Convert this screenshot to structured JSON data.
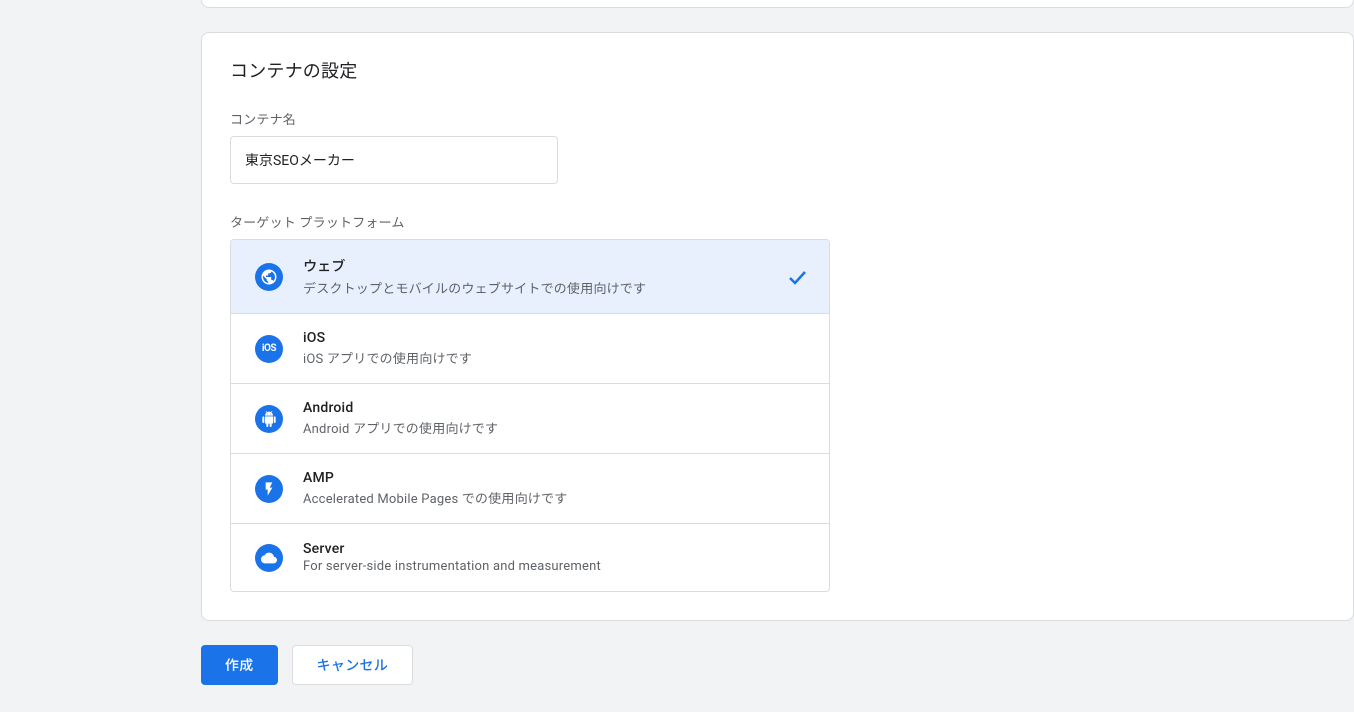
{
  "card": {
    "title": "コンテナの設定",
    "name_label": "コンテナ名",
    "name_value": "東京SEOメーカー",
    "platform_label": "ターゲット プラットフォーム"
  },
  "platforms": {
    "web": {
      "title": "ウェブ",
      "desc": "デスクトップとモバイルのウェブサイトでの使用向けです"
    },
    "ios": {
      "title": "iOS",
      "desc": "iOS アプリでの使用向けです"
    },
    "android": {
      "title": "Android",
      "desc": "Android アプリでの使用向けです"
    },
    "amp": {
      "title": "AMP",
      "desc": "Accelerated Mobile Pages での使用向けです"
    },
    "server": {
      "title": "Server",
      "desc": "For server-side instrumentation and measurement"
    }
  },
  "buttons": {
    "create": "作成",
    "cancel": "キャンセル"
  }
}
